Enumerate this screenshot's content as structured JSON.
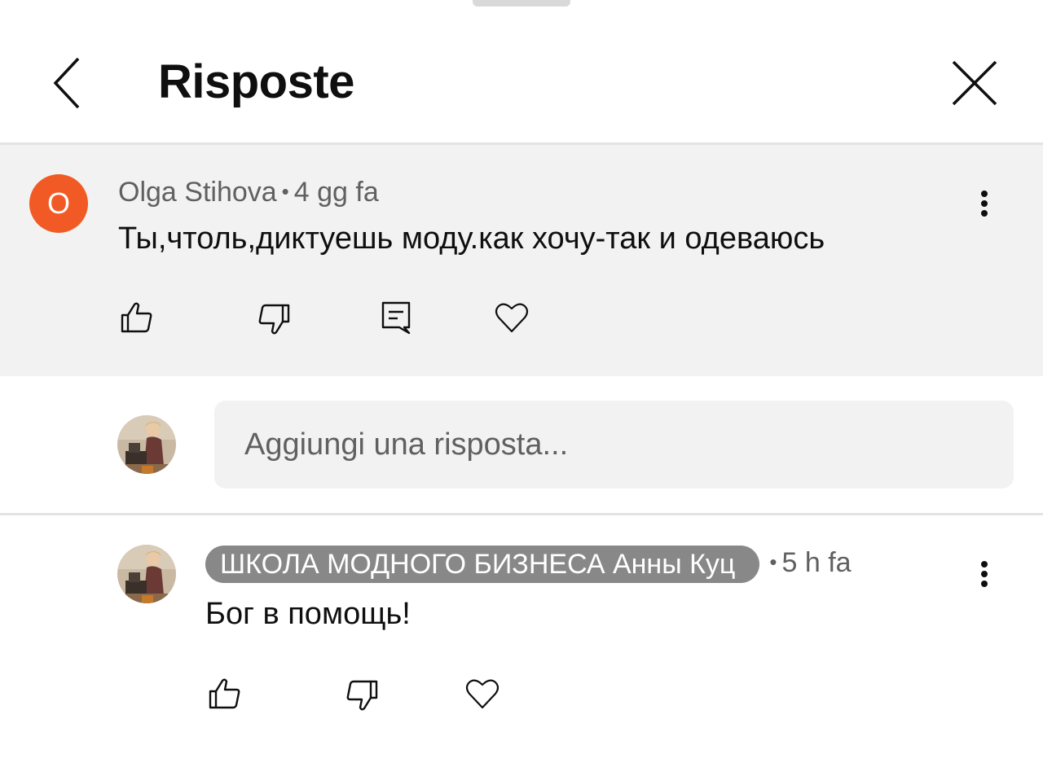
{
  "header": {
    "title": "Risposte"
  },
  "parent_comment": {
    "avatar_letter": "O",
    "avatar_color": "#f15a24",
    "author": "Olga Stihova",
    "separator": "•",
    "time": "4 gg fa",
    "text": "Ты,чтоль,диктуешь моду.как хочу-так и одеваюсь",
    "actions": [
      "thumbs-up-icon",
      "thumbs-down-icon",
      "reply-icon",
      "heart-icon"
    ]
  },
  "reply_box": {
    "placeholder": "Aggiungi una risposta..."
  },
  "reply_comment": {
    "author": "ШКОЛА МОДНОГО БИЗНЕСА Анны Куц",
    "separator": "•",
    "time": "5 h fa",
    "text": "Бог в помощь!",
    "actions": [
      "thumbs-up-icon",
      "thumbs-down-icon",
      "heart-icon"
    ]
  },
  "colors": {
    "background": "#ffffff",
    "parent_background": "#f2f2f2",
    "badge_background": "#888888",
    "meta_text": "#606060"
  }
}
